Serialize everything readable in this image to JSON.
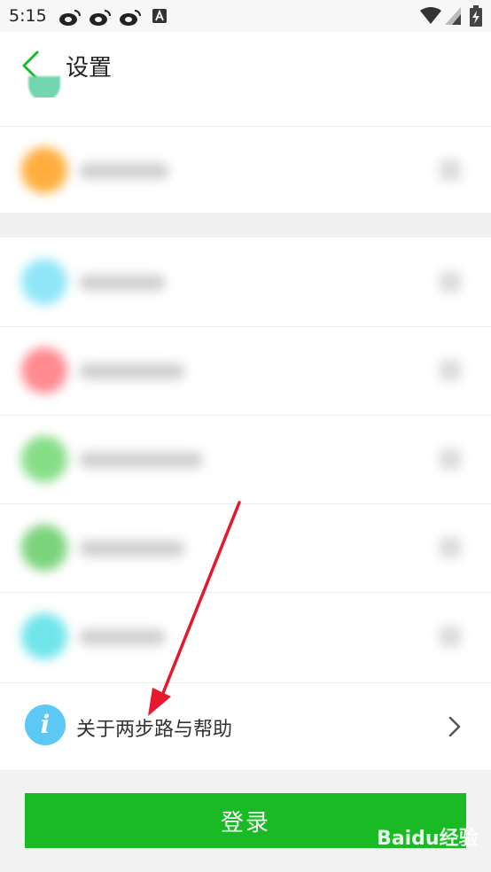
{
  "status_bar": {
    "time": "5:15"
  },
  "header": {
    "title": "设置"
  },
  "about": {
    "label": "关于两步路与帮助"
  },
  "login": {
    "label": "登录"
  },
  "blurred_rows": [
    {
      "color": "#ffae3d"
    },
    {
      "color": "#8fe6f7"
    },
    {
      "color": "#ff8a8f"
    },
    {
      "color": "#86dd86"
    },
    {
      "color": "#7cd37c"
    },
    {
      "color": "#6fe5ea"
    }
  ],
  "watermark": {
    "text": "Baidu经验"
  },
  "colors": {
    "accent": "#1aba24",
    "info_icon": "#5bc8f5",
    "annotation_arrow": "#e8192c"
  }
}
